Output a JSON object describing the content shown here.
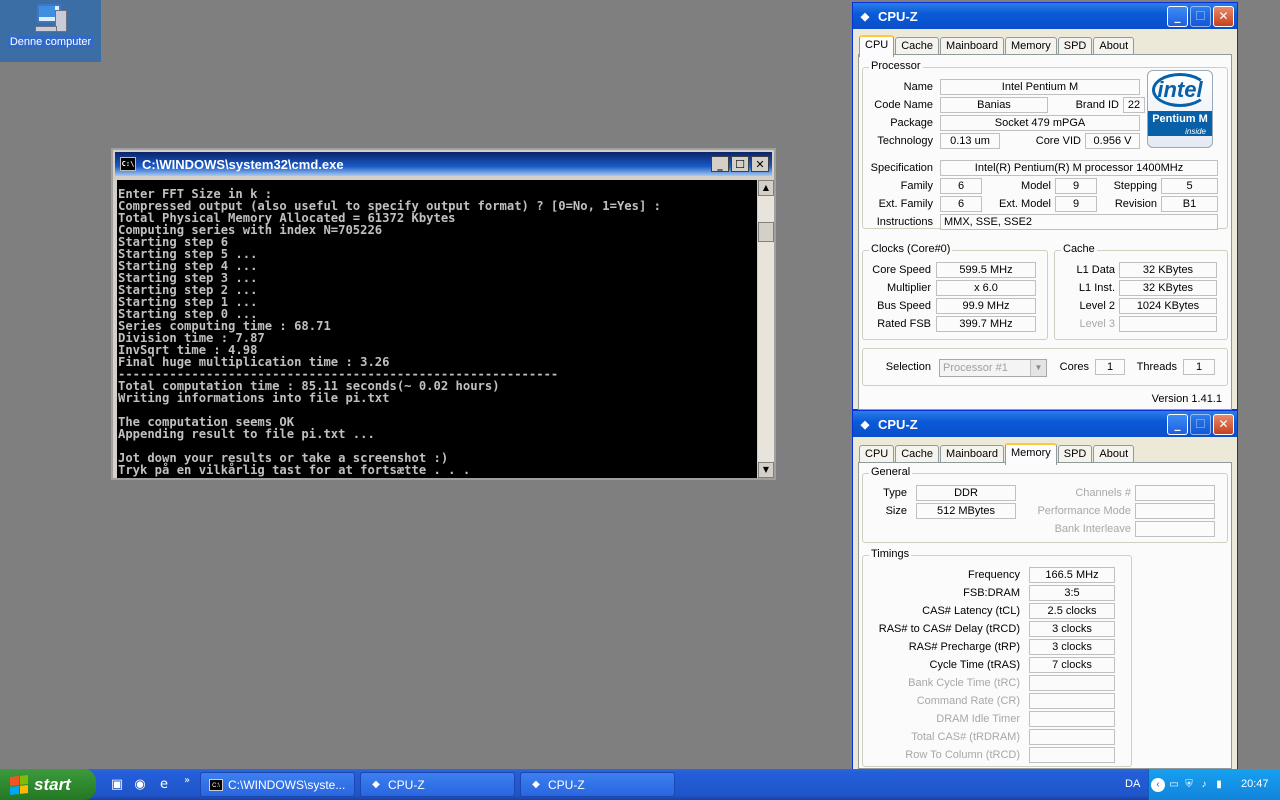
{
  "desktop": {
    "computer_icon_label": "Denne computer"
  },
  "cmd": {
    "title": "C:\\WINDOWS\\system32\\cmd.exe",
    "lines": [
      "Enter FFT Size in k :",
      "Compressed output (also useful to specify output format) ? [0=No, 1=Yes] :",
      "Total Physical Memory Allocated = 61372 Kbytes",
      "Computing series with index N=705226",
      "Starting step 6",
      "Starting step 5 ...",
      "Starting step 4 ...",
      "Starting step 3 ...",
      "Starting step 2 ...",
      "Starting step 1 ...",
      "Starting step 0 ...",
      "Series computing time : 68.71",
      "Division time : 7.87",
      "InvSqrt time : 4.98",
      "Final huge multiplication time : 3.26",
      "------------------------------------------------------------",
      "Total computation time : 85.11 seconds(~ 0.02 hours)",
      "Writing informations into file pi.txt",
      "",
      "The computation seems OK",
      "Appending result to file pi.txt ...",
      "",
      "Jot down your results or take a screenshot :)",
      "Tryk på en vilkårlig tast for at fortsætte . . ."
    ]
  },
  "cpuz_cpu": {
    "title": "CPU-Z",
    "tabs": [
      "CPU",
      "Cache",
      "Mainboard",
      "Memory",
      "SPD",
      "About"
    ],
    "active_tab": "CPU",
    "processor": {
      "group": "Processor",
      "name_label": "Name",
      "name": "Intel Pentium M",
      "codename_label": "Code Name",
      "codename": "Banias",
      "brandid_label": "Brand ID",
      "brandid": "22",
      "package_label": "Package",
      "package": "Socket 479 mPGA",
      "technology_label": "Technology",
      "technology": "0.13 um",
      "corevid_label": "Core VID",
      "corevid": "0.956 V",
      "spec_label": "Specification",
      "spec": "Intel(R) Pentium(R) M processor 1400MHz",
      "family_label": "Family",
      "family": "6",
      "model_label": "Model",
      "model": "9",
      "stepping_label": "Stepping",
      "stepping": "5",
      "extfamily_label": "Ext. Family",
      "extfamily": "6",
      "extmodel_label": "Ext. Model",
      "extmodel": "9",
      "revision_label": "Revision",
      "revision": "B1",
      "instructions_label": "Instructions",
      "instructions": "MMX, SSE, SSE2",
      "logo_brand": "intel",
      "logo_product": "Pentium M",
      "logo_inside": "inside"
    },
    "clocks": {
      "group": "Clocks (Core#0)",
      "corespeed_label": "Core Speed",
      "corespeed": "599.5 MHz",
      "multiplier_label": "Multiplier",
      "multiplier": "x 6.0",
      "busspeed_label": "Bus Speed",
      "busspeed": "99.9 MHz",
      "ratedfsb_label": "Rated FSB",
      "ratedfsb": "399.7 MHz"
    },
    "cache": {
      "group": "Cache",
      "l1data_label": "L1 Data",
      "l1data": "32 KBytes",
      "l1inst_label": "L1 Inst.",
      "l1inst": "32 KBytes",
      "level2_label": "Level 2",
      "level2": "1024 KBytes",
      "level3_label": "Level 3",
      "level3": ""
    },
    "selection_label": "Selection",
    "selection": "Processor #1",
    "cores_label": "Cores",
    "cores": "1",
    "threads_label": "Threads",
    "threads": "1",
    "version": "Version 1.41.1"
  },
  "cpuz_mem": {
    "title": "CPU-Z",
    "tabs": [
      "CPU",
      "Cache",
      "Mainboard",
      "Memory",
      "SPD",
      "About"
    ],
    "active_tab": "Memory",
    "general": {
      "group": "General",
      "type_label": "Type",
      "type": "DDR",
      "size_label": "Size",
      "size": "512 MBytes",
      "channels_label": "Channels #",
      "channels": "",
      "perfmode_label": "Performance Mode",
      "perfmode": "",
      "bankint_label": "Bank Interleave",
      "bankint": ""
    },
    "timings": {
      "group": "Timings",
      "rows": [
        {
          "label": "Frequency",
          "value": "166.5 MHz",
          "dim": false
        },
        {
          "label": "FSB:DRAM",
          "value": "3:5",
          "dim": false
        },
        {
          "label": "CAS# Latency (tCL)",
          "value": "2.5 clocks",
          "dim": false
        },
        {
          "label": "RAS# to CAS# Delay (tRCD)",
          "value": "3 clocks",
          "dim": false
        },
        {
          "label": "RAS# Precharge (tRP)",
          "value": "3 clocks",
          "dim": false
        },
        {
          "label": "Cycle Time (tRAS)",
          "value": "7 clocks",
          "dim": false
        },
        {
          "label": "Bank Cycle Time (tRC)",
          "value": "",
          "dim": true
        },
        {
          "label": "Command Rate (CR)",
          "value": "",
          "dim": true
        },
        {
          "label": "DRAM Idle Timer",
          "value": "",
          "dim": true
        },
        {
          "label": "Total CAS# (tRDRAM)",
          "value": "",
          "dim": true
        },
        {
          "label": "Row To Column (tRCD)",
          "value": "",
          "dim": true
        }
      ]
    }
  },
  "taskbar": {
    "start_label": "start",
    "buttons": [
      "C:\\WINDOWS\\syste...",
      "CPU-Z",
      "CPU-Z"
    ],
    "lang": "DA",
    "clock": "20:47"
  }
}
